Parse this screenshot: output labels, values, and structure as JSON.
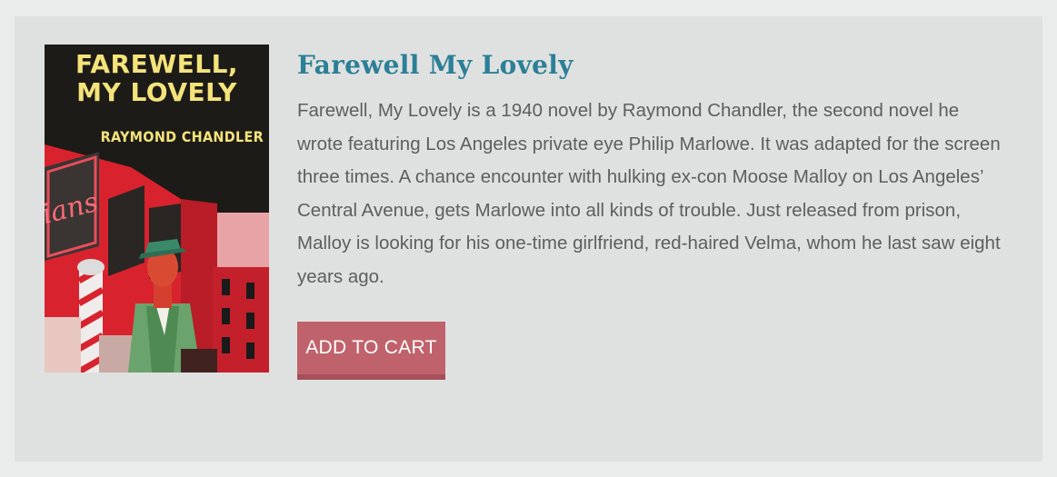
{
  "product": {
    "cover_title": "FAREWELL,\nMY LOVELY",
    "cover_author": "RAYMOND CHANDLER",
    "cover_sign": "ians",
    "title": "Farewell My Lovely",
    "description": "Farewell, My Lovely is a 1940 novel by Raymond Chandler, the second novel he wrote featuring Los Angeles private eye Philip Marlowe. It was adapted for the screen three times. A chance encounter with hulking ex-con Moose Malloy on Los Angeles’ Central Avenue, gets Marlowe into all kinds of trouble. Just released from prison, Malloy is looking for his one-time girlfriend, red-haired Velma, whom he last saw eight years ago.",
    "add_to_cart_label": "ADD TO CART"
  },
  "colors": {
    "page_bg": "#e9eceb",
    "card_bg": "#dfe1e0",
    "title": "#2b7f96",
    "text": "#5c5f5f",
    "button": "#c0626c",
    "cover_yellow": "#f3e37a"
  },
  "icons": {
    "cover_art": "book-cover-image"
  }
}
